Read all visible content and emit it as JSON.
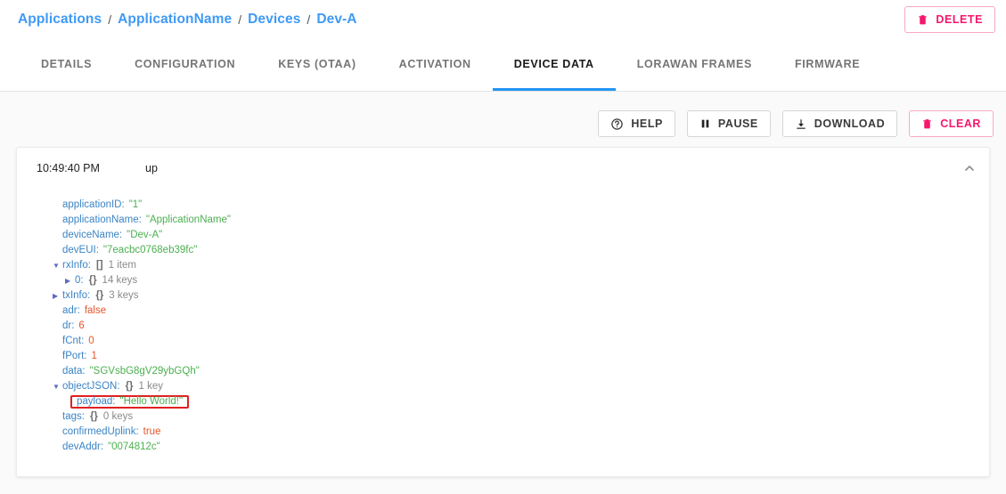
{
  "breadcrumb": {
    "separator": "/",
    "items": [
      {
        "label": "Applications"
      },
      {
        "label": "ApplicationName"
      },
      {
        "label": "Devices"
      },
      {
        "label": "Dev-A"
      }
    ]
  },
  "header": {
    "delete_label": "DELETE"
  },
  "tabs": [
    {
      "label": "DETAILS",
      "active": false
    },
    {
      "label": "CONFIGURATION",
      "active": false
    },
    {
      "label": "KEYS (OTAA)",
      "active": false
    },
    {
      "label": "ACTIVATION",
      "active": false
    },
    {
      "label": "DEVICE DATA",
      "active": true
    },
    {
      "label": "LORAWAN FRAMES",
      "active": false
    },
    {
      "label": "FIRMWARE",
      "active": false
    }
  ],
  "toolbar": {
    "help_label": "HELP",
    "pause_label": "PAUSE",
    "download_label": "DOWNLOAD",
    "clear_label": "CLEAR"
  },
  "frame": {
    "time": "10:49:40 PM",
    "type": "up",
    "collapse_icon": "chevron-up-icon"
  },
  "json_rows": [
    {
      "indent": 0,
      "arrow": "none",
      "key": "applicationID",
      "value": "\"1\"",
      "kind": "string"
    },
    {
      "indent": 0,
      "arrow": "none",
      "key": "applicationName",
      "value": "\"ApplicationName\"",
      "kind": "string"
    },
    {
      "indent": 0,
      "arrow": "none",
      "key": "deviceName",
      "value": "\"Dev-A\"",
      "kind": "string"
    },
    {
      "indent": 0,
      "arrow": "none",
      "key": "devEUI",
      "value": "\"7eacbc0768eb39fc\"",
      "kind": "string"
    },
    {
      "indent": 0,
      "arrow": "expanded",
      "key": "rxInfo",
      "bracket": "[]",
      "meta": "1 item",
      "kind": "array"
    },
    {
      "indent": 1,
      "arrow": "collapsed",
      "key": "0",
      "bracket": "{}",
      "meta": "14 keys",
      "kind": "object"
    },
    {
      "indent": 0,
      "arrow": "collapsed",
      "key": "txInfo",
      "bracket": "{}",
      "meta": "3 keys",
      "kind": "object"
    },
    {
      "indent": 0,
      "arrow": "none",
      "key": "adr",
      "value": "false",
      "kind": "bool"
    },
    {
      "indent": 0,
      "arrow": "none",
      "key": "dr",
      "value": "6",
      "kind": "number"
    },
    {
      "indent": 0,
      "arrow": "none",
      "key": "fCnt",
      "value": "0",
      "kind": "number"
    },
    {
      "indent": 0,
      "arrow": "none",
      "key": "fPort",
      "value": "1",
      "kind": "number"
    },
    {
      "indent": 0,
      "arrow": "none",
      "key": "data",
      "value": "\"SGVsbG8gV29ybGQh\"",
      "kind": "string"
    },
    {
      "indent": 0,
      "arrow": "expanded",
      "key": "objectJSON",
      "bracket": "{}",
      "meta": "1 key",
      "kind": "object"
    },
    {
      "indent": 1,
      "arrow": "none",
      "key": "payload",
      "value": "\"Hello World!\"",
      "kind": "string",
      "highlight": true
    },
    {
      "indent": 0,
      "arrow": "none",
      "key": "tags",
      "bracket": "{}",
      "meta": "0 keys",
      "kind": "object"
    },
    {
      "indent": 0,
      "arrow": "none",
      "key": "confirmedUplink",
      "value": "true",
      "kind": "bool"
    },
    {
      "indent": 0,
      "arrow": "none",
      "key": "devAddr",
      "value": "\"0074812c\"",
      "kind": "string"
    }
  ],
  "colors": {
    "link": "#3f9af5",
    "accent": "#2196f3",
    "danger": "#f5176b",
    "highlight": "#e02020",
    "json_key": "#3a84c4",
    "json_string": "#4caf50",
    "json_number": "#e8552a"
  }
}
